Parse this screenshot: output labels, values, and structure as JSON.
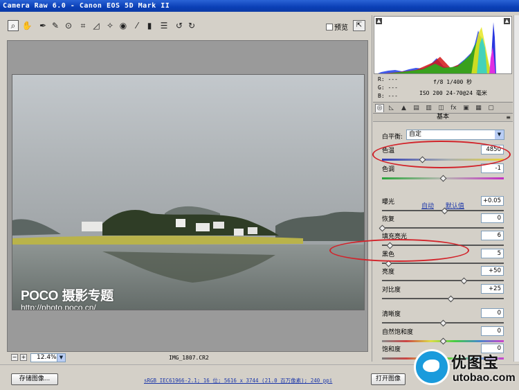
{
  "window": {
    "title": "Camera Raw 6.0 -  Canon EOS 5D Mark II"
  },
  "toolbar": {
    "tools": [
      "zoom-icon",
      "hand-icon",
      "white-balance-icon",
      "color-sampler-icon",
      "target-adjust-icon",
      "crop-icon",
      "straighten-icon",
      "spot-removal-icon",
      "red-eye-icon",
      "adjustment-brush-icon",
      "graduated-filter-icon",
      "preferences-icon",
      "rotate-ccw-icon",
      "rotate-cw-icon"
    ],
    "preview_label": "预览"
  },
  "photo": {
    "watermark_logo": "POCO",
    "watermark_logo_cn": "摄影专题",
    "watermark_url": "http://photo.poco.cn/"
  },
  "status": {
    "zoom": "12.4%",
    "filename": "IMG_1807.CR2"
  },
  "readout": {
    "r": "R:  ---",
    "g": "G:  ---",
    "b": "B:  ---",
    "exposure": "f/8   1/400 秒",
    "iso_lens": "ISO 200   24-70@24 毫米"
  },
  "panel": {
    "section_title": "基本",
    "white_balance_label": "白平衡:",
    "white_balance_value": "自定",
    "auto_label": "自动",
    "default_label": "默认值",
    "sliders": [
      {
        "key": "temperature",
        "label": "色温",
        "value": "4850",
        "pos": 0.33
      },
      {
        "key": "tint",
        "label": "色调",
        "value": "-1",
        "pos": 0.5
      },
      {
        "key": "exposure",
        "label": "曝光",
        "value": "+0.05",
        "pos": 0.51
      },
      {
        "key": "recovery",
        "label": "恢复",
        "value": "0",
        "pos": 0.0
      },
      {
        "key": "fill-light",
        "label": "填充亮光",
        "value": "6",
        "pos": 0.06
      },
      {
        "key": "blacks",
        "label": "黑色",
        "value": "5",
        "pos": 0.05
      },
      {
        "key": "brightness",
        "label": "亮度",
        "value": "+50",
        "pos": 0.67
      },
      {
        "key": "contrast",
        "label": "对比度",
        "value": "+25",
        "pos": 0.56
      },
      {
        "key": "clarity",
        "label": "清晰度",
        "value": "0",
        "pos": 0.5
      },
      {
        "key": "vibrance",
        "label": "自然饱和度",
        "value": "0",
        "pos": 0.5
      },
      {
        "key": "saturation",
        "label": "饱和度",
        "value": "0",
        "pos": 0.5
      }
    ]
  },
  "bottom": {
    "save_label": "存储图像...",
    "workflow_link": "sRGB IEC61966-2.1; 16 位; 5616 x 3744 (21.0 百万像素); 240 ppi",
    "open_label": "打开图像"
  },
  "brand": {
    "name_cn": "优图宝",
    "url": "utobao.com"
  },
  "colors": {
    "title_blue": "#0a3fb6",
    "annotation_red": "#d2232a",
    "link_blue": "#1a35a8"
  }
}
